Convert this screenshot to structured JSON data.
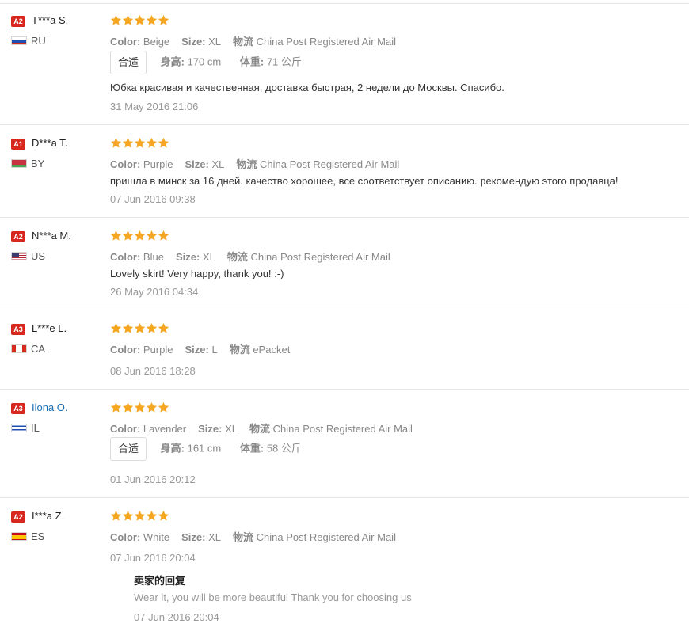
{
  "labels": {
    "color": "Color:",
    "size": "Size:",
    "logistics": "物流",
    "height": "身高:",
    "weight": "体重:",
    "fit": "合适"
  },
  "colors": {
    "star": "#f5a623",
    "badge": "#d7271f",
    "link": "#1a6fb4"
  },
  "reviews": [
    {
      "badge": "A2",
      "name": "T***a S.",
      "country": "RU",
      "flag": "flag-russia",
      "rating": 5,
      "color": "Beige",
      "size": "XL",
      "shipping": "China Post Registered Air Mail",
      "fit": "合适",
      "height": "170 cm",
      "weight": "71 公斤",
      "text": "Юбка красивая и качественная, доставка быстрая, 2 недели до Москвы. Спасибо.",
      "date": "31 May 2016 21:06"
    },
    {
      "badge": "A1",
      "name": "D***a T.",
      "country": "BY",
      "flag": "flag-belarus",
      "rating": 5,
      "color": "Purple",
      "size": "XL",
      "shipping": "China Post Registered Air Mail",
      "text": "пришла в минск за 16 дней. качество хорошее, все соответствует описанию. рекомендую этого продавца!",
      "date": "07 Jun 2016 09:38"
    },
    {
      "badge": "A2",
      "name": "N***a M.",
      "country": "US",
      "flag": "flag-usa",
      "rating": 5,
      "color": "Blue",
      "size": "XL",
      "shipping": "China Post Registered Air Mail",
      "text": "Lovely skirt! Very happy, thank you! :-)",
      "date": "26 May 2016 04:34"
    },
    {
      "badge": "A3",
      "name": "L***e L.",
      "country": "CA",
      "flag": "flag-canada",
      "rating": 5,
      "color": "Purple",
      "size": "L",
      "shipping": "ePacket",
      "text": "",
      "date": "08 Jun 2016 18:28"
    },
    {
      "badge": "A3",
      "name": "Ilona O.",
      "country": "IL",
      "flag": "flag-israel",
      "rating": 5,
      "color": "Lavender",
      "size": "XL",
      "shipping": "China Post Registered Air Mail",
      "fit": "合适",
      "height": "161 cm",
      "weight": "58 公斤",
      "text": "",
      "date": "01 Jun 2016 20:12"
    },
    {
      "badge": "A2",
      "name": "I***a Z.",
      "country": "ES",
      "flag": "flag-spain",
      "rating": 5,
      "color": "White",
      "size": "XL",
      "shipping": "China Post Registered Air Mail",
      "text": "",
      "date": "07 Jun 2016 20:04",
      "reply": {
        "title": "卖家的回复",
        "text": "Wear it, you will be more beautiful Thank you for choosing us",
        "date": "07 Jun 2016 20:04"
      }
    }
  ]
}
